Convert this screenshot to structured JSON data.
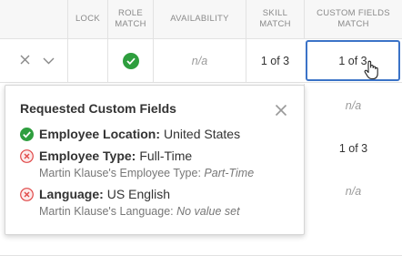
{
  "header": {
    "lock": "LOCK",
    "role_match": "ROLE MATCH",
    "availability": "AVAILABILITY",
    "skill_match": "SKILL MATCH",
    "custom_fields_match": "CUSTOM FIELDS MATCH"
  },
  "rows": [
    {
      "availability": "n/a",
      "skill": "1 of 3",
      "custom": "1 of 3",
      "role_match": "check-icon"
    },
    {
      "custom": "n/a"
    },
    {
      "custom": "1 of 3"
    },
    {
      "custom": "n/a"
    }
  ],
  "popover": {
    "title": "Requested Custom Fields",
    "items": [
      {
        "status": "match",
        "field": "Employee Location:",
        "value": "United States"
      },
      {
        "status": "mismatch",
        "field": "Employee Type:",
        "value": "Full-Time",
        "detail_label": "Martin Klause's Employee Type:",
        "detail_value": "Part-Time"
      },
      {
        "status": "mismatch",
        "field": "Language:",
        "value": "US English",
        "detail_label": "Martin Klause's Language:",
        "detail_value": "No value set"
      }
    ]
  },
  "colors": {
    "accent": "#3b73c7",
    "match_green": "#2e9e3e",
    "mismatch_red": "#e04848"
  }
}
